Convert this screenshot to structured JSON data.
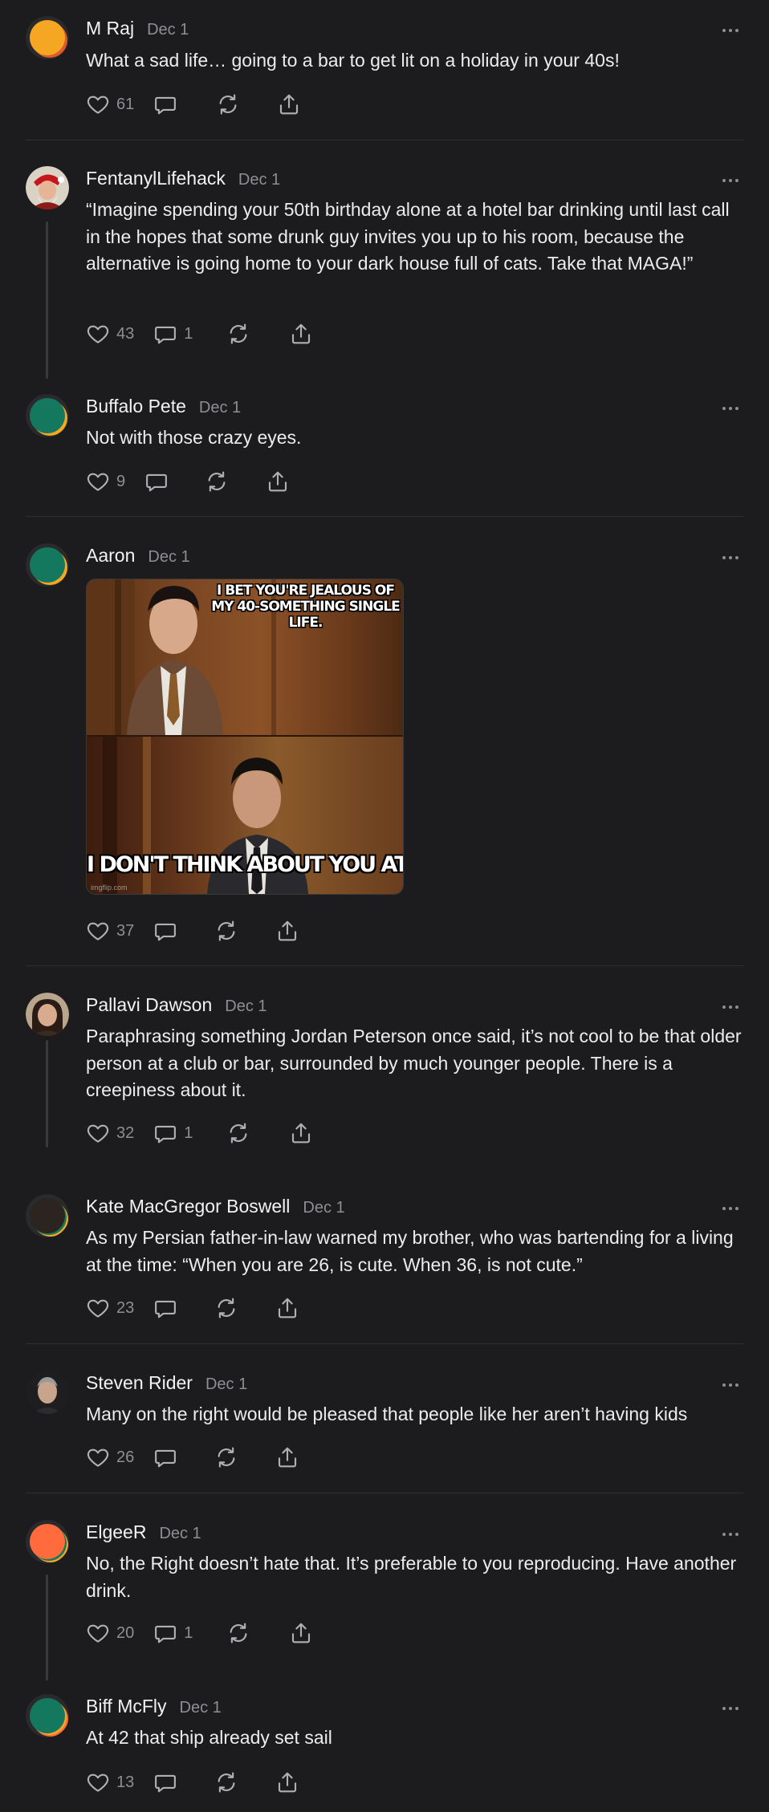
{
  "posts": [
    {
      "author": "M Raj",
      "date": "Dec 1",
      "avatar": "brand-orange",
      "text": "What a sad life… going to a bar to get lit on a holiday in your 40s!",
      "likes": "61",
      "replies": ""
    },
    {
      "author": "FentanylLifehack",
      "date": "Dec 1",
      "avatar": "santa-photo",
      "text": "“Imagine spending your 50th birthday alone at a hotel bar drinking until last call in the hopes that some drunk guy invites you up to his room, because the alternative is going home to your dark house full of cats. Take that MAGA!”",
      "likes": "43",
      "replies": "1"
    },
    {
      "author": "Buffalo Pete",
      "date": "Dec 1",
      "avatar": "brand-teal",
      "text": "Not with those crazy eyes.",
      "likes": "9",
      "replies": ""
    },
    {
      "author": "Aaron",
      "date": "Dec 1",
      "avatar": "brand-teal",
      "text": "",
      "likes": "37",
      "replies": "",
      "image": {
        "caption_top": "I BET YOU'RE JEALOUS OF MY 40-SOMETHING SINGLE LIFE.",
        "caption_bottom": "I DON'T THINK ABOUT YOU AT ALL",
        "watermark": "imgflip.com"
      }
    },
    {
      "author": "Pallavi Dawson",
      "date": "Dec 1",
      "avatar": "woman-photo",
      "text": "Paraphrasing something Jordan Peterson once said, it’s not cool to be that older person at a club or bar, surrounded by much younger people. There is a creepiness about it.",
      "likes": "32",
      "replies": "1"
    },
    {
      "author": "Kate MacGregor Boswell",
      "date": "Dec 1",
      "avatar": "brand-dark",
      "text": "As my Persian father-in-law warned my brother, who was bartending for a living at the time: “When you are 26, is cute. When 36, is not cute.”",
      "likes": "23",
      "replies": ""
    },
    {
      "author": "Steven Rider",
      "date": "Dec 1",
      "avatar": "man-photo",
      "text": "Many on the right would be pleased that people like her aren’t having kids",
      "likes": "26",
      "replies": ""
    },
    {
      "author": "ElgeeR",
      "date": "Dec 1",
      "avatar": "brand-coral",
      "text": "No, the Right doesn’t hate that. It’s preferable to you reproducing. Have another drink.",
      "likes": "20",
      "replies": "1"
    },
    {
      "author": "Biff McFly",
      "date": "Dec 1",
      "avatar": "brand-teal",
      "text": "At 42 that ship already set sail",
      "likes": "13",
      "replies": ""
    }
  ],
  "colors": {
    "background": "#1c1c1e",
    "text": "#ececec",
    "muted": "#8e8e93",
    "separator": "#2e2e30"
  }
}
